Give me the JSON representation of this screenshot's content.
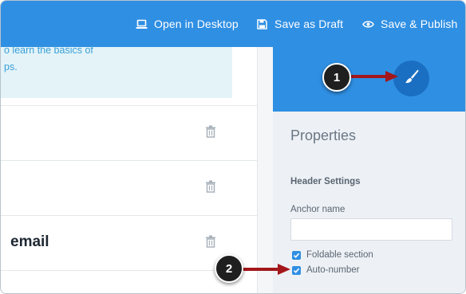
{
  "toolbar": {
    "open_desktop_label": "Open in Desktop",
    "save_draft_label": "Save as Draft",
    "save_publish_label": "Save & Publish",
    "background_color": "#2f8fe3"
  },
  "editor": {
    "notice_line1": "o learn the basics of",
    "notice_line2": "ps.",
    "rows": [
      {
        "title": ""
      },
      {
        "title": ""
      },
      {
        "title": "email"
      }
    ]
  },
  "properties_panel": {
    "title": "Properties",
    "section_heading": "Header Settings",
    "anchor_name_label": "Anchor name",
    "anchor_name_value": "",
    "foldable_section": {
      "label": "Foldable section",
      "checked": true
    },
    "auto_number": {
      "label": "Auto-number",
      "checked": true
    }
  },
  "annotations": {
    "callout1": "1",
    "callout2": "2",
    "arrow_color": "#a3171b"
  },
  "icons": {
    "open_desktop": "laptop-icon",
    "save_draft": "floppy-disk-icon",
    "save_publish": "eye-icon",
    "row_action": "trash-icon",
    "theme_button": "paintbrush-icon"
  }
}
